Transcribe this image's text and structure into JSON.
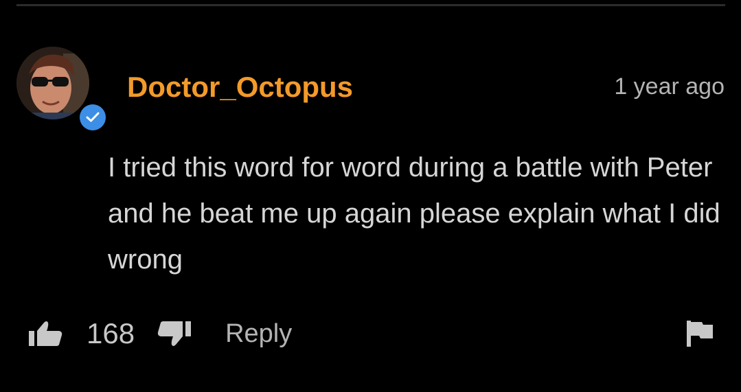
{
  "comment": {
    "author": "Doctor_Octopus",
    "timestamp": "1 year ago",
    "text": "I tried this word for word during a battle with Peter and he beat me up again please explain what I did wrong",
    "verified": true
  },
  "actions": {
    "like_count": "168",
    "reply_label": "Reply"
  },
  "icons": {
    "like": "thumbs-up-icon",
    "dislike": "thumbs-down-icon",
    "flag": "flag-icon",
    "verified": "checkmark-icon"
  },
  "colors": {
    "background": "#000000",
    "author": "#f39a2a",
    "text": "#d6d6d6",
    "muted": "#b4b4b4",
    "badge": "#3d8ee6"
  }
}
